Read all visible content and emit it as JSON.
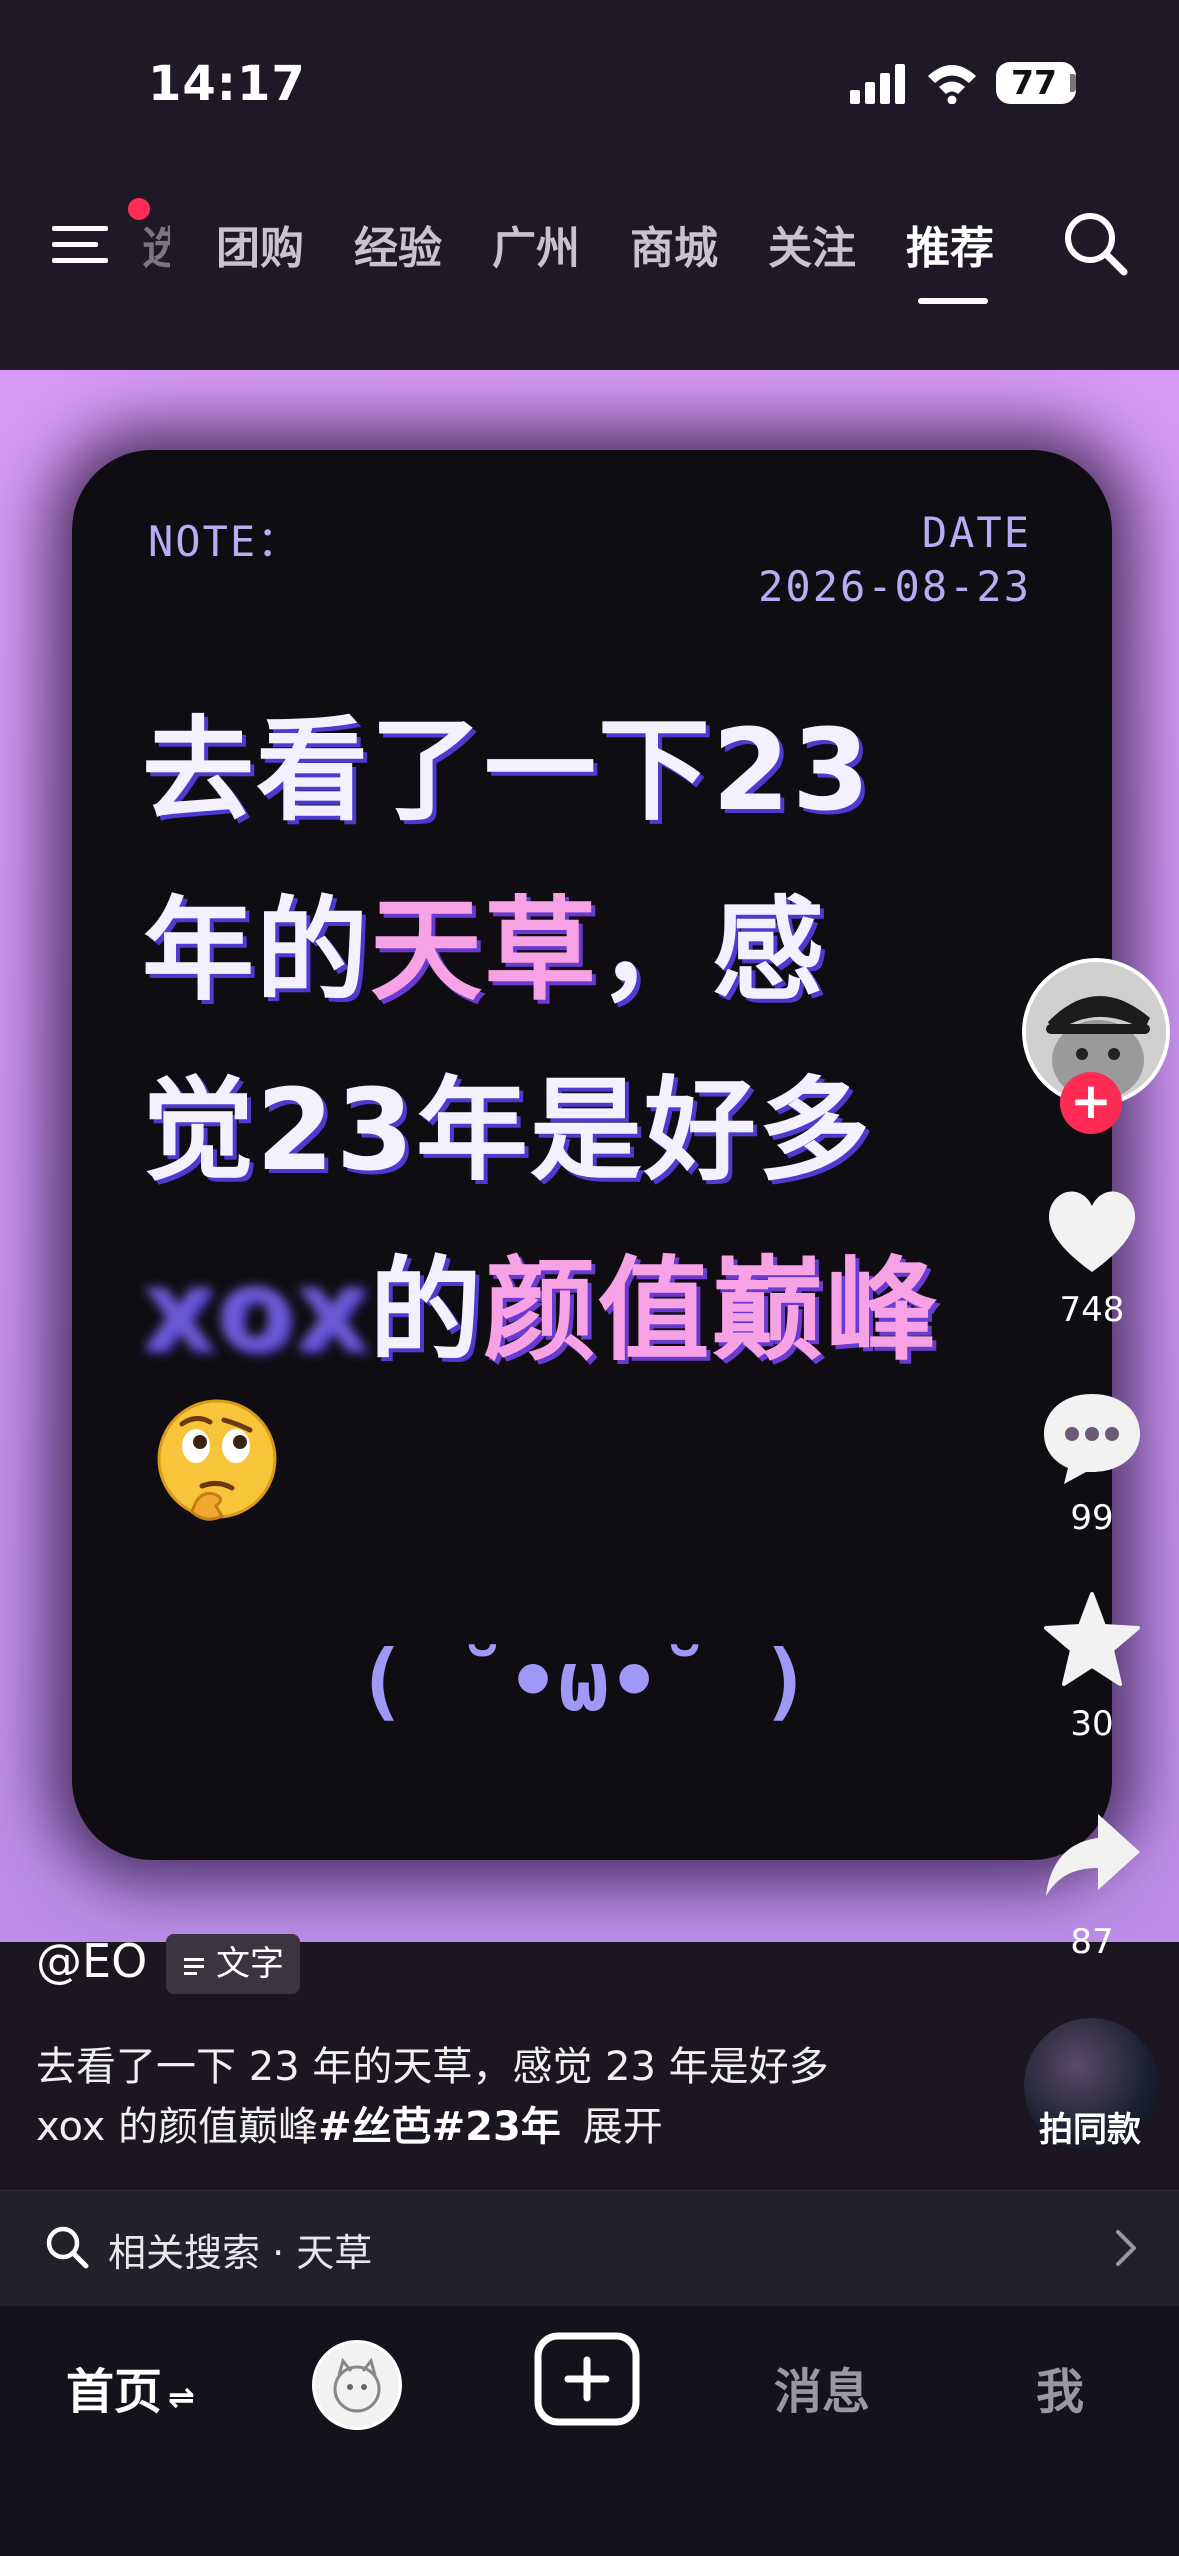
{
  "status": {
    "time": "14:17",
    "battery": "77"
  },
  "nav": {
    "partial_tab": "选",
    "tabs": [
      "团购",
      "经验",
      "广州",
      "商城",
      "关注",
      "推荐"
    ],
    "active": "推荐"
  },
  "note": {
    "note_label": "NOTE：",
    "date_label": "DATE",
    "date_value": "2026-08-23",
    "line1": "去看了一下23",
    "line2_a": "年的",
    "line2_b": "天草",
    "line2_c": "，感",
    "line3": "觉23年是好多",
    "line4_blur": "xox",
    "line4_a": "的",
    "line4_b": "颜值巅峰",
    "kaomoji": "( ˘•ω•˘ )"
  },
  "rail": {
    "likes": "748",
    "comments": "99",
    "favorites": "30",
    "shares": "87"
  },
  "caption": {
    "author": "@EO",
    "tag": "文字",
    "line1": "去看了一下 23 年的天草，感觉 23 年是好多",
    "line2_text": "xox 的颜值巅峰",
    "line2_tags": "#丝芭#23年",
    "expand": "展开",
    "same_style": "拍同款"
  },
  "related": {
    "label": "相关搜索 · 天草"
  },
  "tabbar": {
    "home": "首页",
    "messages": "消息",
    "me": "我"
  }
}
